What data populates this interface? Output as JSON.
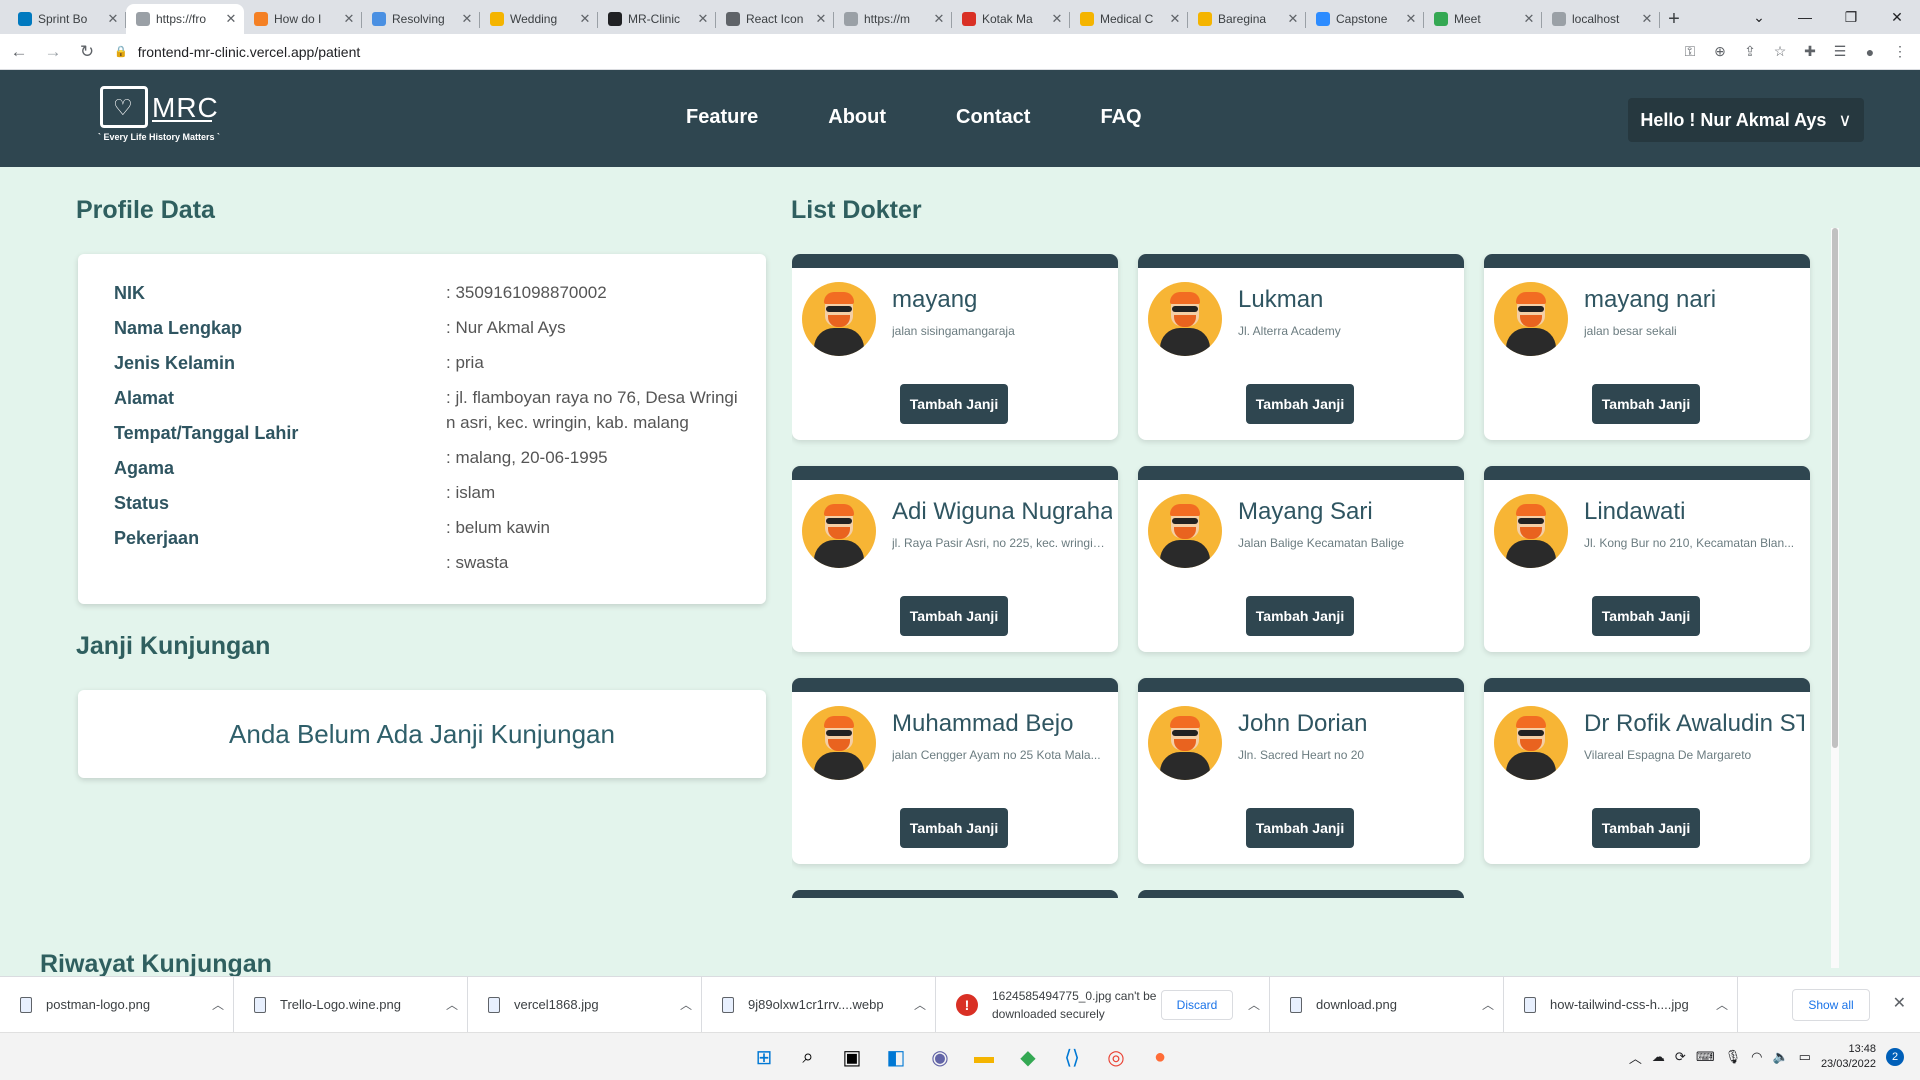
{
  "browser": {
    "tabs": [
      {
        "label": "Sprint Bo",
        "color": "#0079bf"
      },
      {
        "label": "https://fro",
        "color": "#9aa0a6"
      },
      {
        "label": "How do I",
        "color": "#f48024"
      },
      {
        "label": "Resolving",
        "color": "#4a90e2"
      },
      {
        "label": "Wedding",
        "color": "#f4b400"
      },
      {
        "label": "MR-Clinic",
        "color": "#202124"
      },
      {
        "label": "React Icon",
        "color": "#5f6368"
      },
      {
        "label": "https://m",
        "color": "#9aa0a6"
      },
      {
        "label": "Kotak Ma",
        "color": "#d93025"
      },
      {
        "label": "Medical C",
        "color": "#f4b400"
      },
      {
        "label": "Baregina",
        "color": "#f4b400"
      },
      {
        "label": "Capstone",
        "color": "#2d8cff"
      },
      {
        "label": "Meet",
        "color": "#34a853"
      },
      {
        "label": "localhost",
        "color": "#9aa0a6"
      }
    ],
    "new_tab": "+",
    "url": "frontend-mr-clinic.vercel.app/patient"
  },
  "navbar": {
    "logo_text": "MRC",
    "logo_tagline": "` Every Life History Matters `",
    "links": [
      "Feature",
      "About",
      "Contact",
      "FAQ"
    ],
    "user_greeting": "Hello ! Nur Akmal Ays"
  },
  "profile": {
    "title": "Profile Data",
    "labels": [
      "NIK",
      "Nama Lengkap",
      "Jenis Kelamin",
      "Alamat",
      "Tempat/Tanggal Lahir",
      "Agama",
      "Status",
      "Pekerjaan"
    ],
    "values": [
      ": 3509161098870002",
      ": Nur Akmal Ays",
      ": pria",
      ": jl. flamboyan raya no 76, Desa Wringi n asri, kec. wringin, kab. malang",
      ": malang, 20-06-1995",
      ": islam",
      ": belum kawin",
      ": swasta"
    ]
  },
  "janji": {
    "title": "Janji Kunjungan",
    "empty_text": "Anda Belum Ada Janji Kunjungan"
  },
  "riwayat": {
    "title": "Riwayat Kunjungan"
  },
  "doctors": {
    "title": "List Dokter",
    "button_label": "Tambah Janji",
    "items": [
      {
        "name": "mayang",
        "address": "jalan sisingamangaraja"
      },
      {
        "name": "Lukman",
        "address": "Jl. Alterra Academy"
      },
      {
        "name": "mayang nari",
        "address": "jalan besar sekali"
      },
      {
        "name": "Adi Wiguna Nugraha",
        "address": "jl. Raya Pasir Asri, no 225, kec. wringin..."
      },
      {
        "name": "Mayang Sari",
        "address": "Jalan Balige Kecamatan Balige"
      },
      {
        "name": "Lindawati",
        "address": "Jl. Kong Bur no 210, Kecamatan Blan..."
      },
      {
        "name": "Muhammad Bejo",
        "address": "jalan Cengger Ayam no 25 Kota Mala..."
      },
      {
        "name": "John Dorian",
        "address": "Jln. Sacred Heart no 20"
      },
      {
        "name": "Dr Rofik Awaludin ST",
        "address": "Vilareal Espagna De Margareto"
      }
    ]
  },
  "downloads": {
    "items": [
      {
        "name": "postman-logo.png"
      },
      {
        "name": "Trello-Logo.wine.png"
      },
      {
        "name": "vercel1868.jpg"
      },
      {
        "name": "9j89olxw1cr1rrv....webp"
      }
    ],
    "error_item": {
      "text": "1624585494775_0.jpg can't be downloaded securely",
      "action": "Discard"
    },
    "items_after": [
      {
        "name": "download.png"
      },
      {
        "name": "how-tailwind-css-h....jpg"
      }
    ],
    "show_all": "Show all"
  },
  "taskbar": {
    "time": "13:48",
    "date": "23/03/2022",
    "notifications": "2"
  }
}
